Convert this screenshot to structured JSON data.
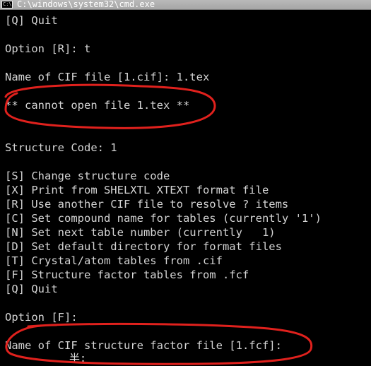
{
  "window": {
    "title": "C:\\windows\\system32\\cmd.exe",
    "icon_label": "C:\\"
  },
  "console_lines": [
    "[Q] Quit",
    "",
    "Option [R]: t",
    "",
    "Name of CIF file [1.cif]: 1.tex",
    "",
    "** cannot open file 1.tex **",
    "",
    "",
    "Structure Code: 1",
    "",
    "[S] Change structure code",
    "[X] Print from SHELXTL XTEXT format file",
    "[R] Use another CIF file to resolve ? items",
    "[C] Set compound name for tables (currently '1')",
    "[N] Set next table number (currently   1)",
    "[D] Set default directory for format files",
    "[T] Crystal/atom tables from .cif",
    "[F] Structure factor tables from .fcf",
    "[Q] Quit",
    "",
    "Option [F]:",
    "",
    "Name of CIF structure factor file [1.fcf]:"
  ],
  "input_cursor_text": "半:",
  "annotations": {
    "color": "#e0211d",
    "marks": [
      "error-message-circle",
      "prompt-circle"
    ]
  }
}
